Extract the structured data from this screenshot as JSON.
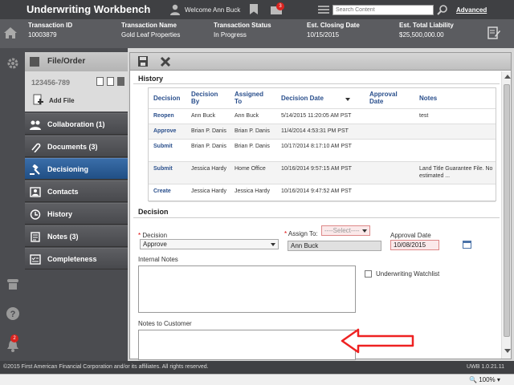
{
  "app": {
    "title": "Underwriting Workbench",
    "welcome": "Welcome Ann Buck",
    "mail_count": "3",
    "search_placeholder": "Search Content",
    "advanced": "Advanced"
  },
  "summary": [
    {
      "label": "Transaction ID",
      "value": "10003879"
    },
    {
      "label": "Transaction Name",
      "value": "Gold Leaf Properties"
    },
    {
      "label": "Transaction Status",
      "value": "In Progress"
    },
    {
      "label": "Est. Closing Date",
      "value": "10/15/2015"
    },
    {
      "label": "Est. Total Liability",
      "value": "$25,500,000.00"
    }
  ],
  "rail": {
    "notifications": "2"
  },
  "nav": {
    "file_order": "File/Order",
    "file_number": "123456-789",
    "add_file": "Add File",
    "items": [
      {
        "label": "Collaboration (1)"
      },
      {
        "label": "Documents (3)"
      },
      {
        "label": "Decisioning"
      },
      {
        "label": "Contacts"
      },
      {
        "label": "History"
      },
      {
        "label": "Notes (3)"
      },
      {
        "label": "Completeness"
      }
    ]
  },
  "history": {
    "title": "History",
    "headers": [
      "Decision",
      "Decision By",
      "Assigned To",
      "Decision Date",
      "Approval Date",
      "Notes"
    ],
    "rows": [
      [
        "Reopen",
        "Ann Buck",
        "Ann Buck",
        "5/14/2015 11:20:05 AM PST",
        "",
        "test"
      ],
      [
        "Approve",
        "Brian P. Danis",
        "Brian P. Danis",
        "11/4/2014 4:53:31 PM PST",
        "",
        ""
      ],
      [
        "Submit",
        "Brian P. Danis",
        "Brian P. Danis",
        "10/17/2014 8:17:10 AM PST",
        "",
        ""
      ],
      [
        "Submit",
        "Jessica Hardy",
        "Home Office",
        "10/16/2014 9:57:15 AM PST",
        "",
        "Land Title Guarantee File. No estimated ..."
      ],
      [
        "Create",
        "Jessica Hardy",
        "Jessica Hardy",
        "10/16/2014 9:47:52 AM PST",
        "",
        ""
      ]
    ]
  },
  "decision": {
    "title": "Decision",
    "decision_label": "Decision",
    "decision_value": "Approve",
    "assign_label": "Assign To:",
    "assign_select": "----Select----",
    "assign_value": "Ann Buck",
    "approval_label": "Approval Date",
    "approval_value": "10/08/2015",
    "internal_notes": "Internal Notes",
    "watchlist": "Underwriting Watchlist",
    "notes_customer": "Notes to Customer"
  },
  "footer": {
    "copyright": "©2015 First American Financial Corporation and/or its affiliates. All rights reserved.",
    "version": "UWB 1.0.21.11",
    "zoom": "100%"
  },
  "colors": {
    "accent": "#2a5d99",
    "alert": "#d9231f"
  }
}
